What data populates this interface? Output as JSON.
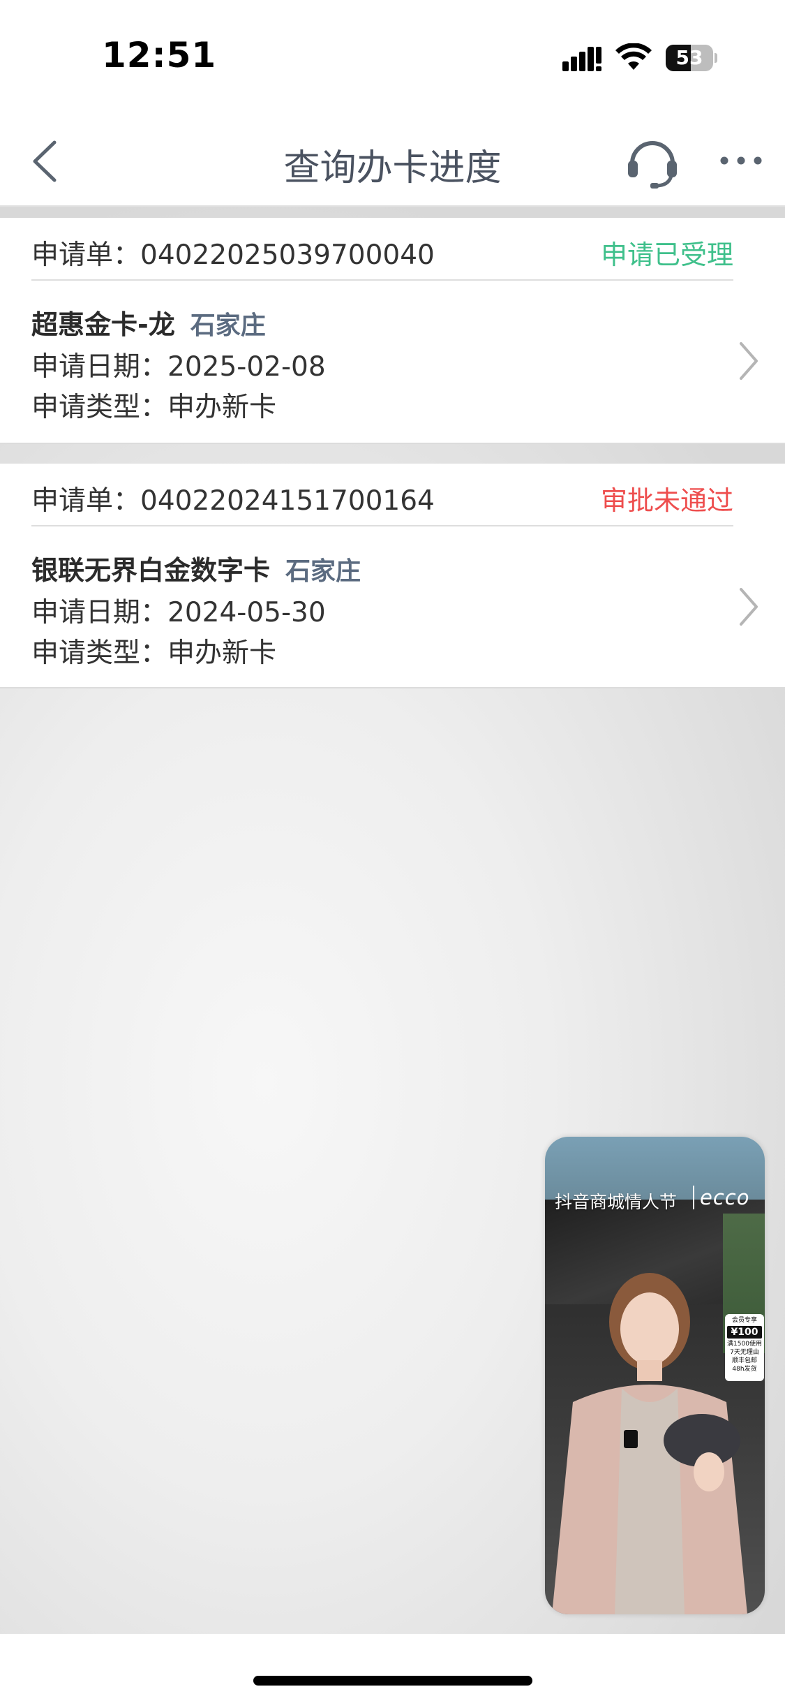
{
  "status_bar": {
    "time": "12:51",
    "battery": "53"
  },
  "nav": {
    "title": "查询办卡进度"
  },
  "applications": [
    {
      "number_label": "申请单：04022025039700040",
      "status": "申请已受理",
      "status_color": "#3fc08b",
      "card_name": "超惠金卡-龙",
      "city": "石家庄",
      "date_line": "申请日期：2025-02-08",
      "type_line": "申请类型：申办新卡"
    },
    {
      "number_label": "申请单：04022024151700164",
      "status": "审批未通过",
      "status_color": "#ee4e4e",
      "card_name": "银联无界白金数字卡",
      "city": "石家庄",
      "date_line": "申请日期：2024-05-30",
      "type_line": "申请类型：申办新卡"
    }
  ],
  "video_ad": {
    "title": "抖音商城情人节",
    "brand": "ecco",
    "promo_header": "会员专享",
    "promo_price": "¥100",
    "promo_lines": [
      "满1500使用",
      "7天无理由",
      "顺丰包邮",
      "48h发货"
    ]
  }
}
